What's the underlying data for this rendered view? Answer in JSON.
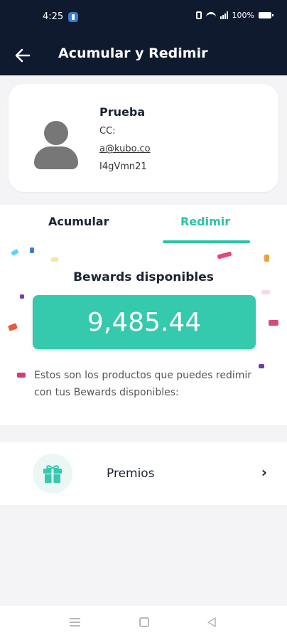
{
  "status_bar": {
    "time": "4:25",
    "battery": "100%"
  },
  "app_bar": {
    "title": "Acumular y Redimir",
    "back_icon": "back-arrow-icon"
  },
  "profile": {
    "name": "Prueba",
    "id_label": "CC:",
    "email": "a@kubo.co",
    "code": "I4gVmn21"
  },
  "tabs": [
    {
      "label": "Acumular",
      "active": false
    },
    {
      "label": "Redimir",
      "active": true
    }
  ],
  "balance": {
    "title": "Bewards disponibles",
    "value": "9,485.44",
    "message": "Estos son los productos que puedes redimir con tus Bewards disponibles:"
  },
  "menu": [
    {
      "label": "Premios",
      "icon": "gift-icon"
    }
  ],
  "colors": {
    "header": "#0f1a2f",
    "accent": "#2cc4a6",
    "balance_box": "#35c9ad"
  }
}
